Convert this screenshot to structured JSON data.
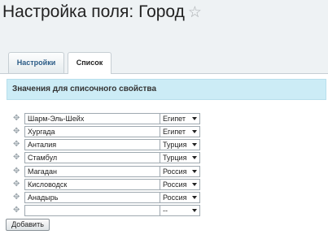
{
  "page": {
    "title": "Настройка поля: Город",
    "star_icon": "☆"
  },
  "tabs": [
    {
      "label": "Настройки"
    },
    {
      "label": "Список"
    }
  ],
  "section": {
    "title": "Значения для списочного свойства"
  },
  "rows": [
    {
      "value": "Шарм-Эль-Шейх",
      "country": "Египет"
    },
    {
      "value": "Хургада",
      "country": "Египет"
    },
    {
      "value": "Анталия",
      "country": "Турция"
    },
    {
      "value": "Стамбул",
      "country": "Турция"
    },
    {
      "value": "Магадан",
      "country": "Россия"
    },
    {
      "value": "Кисловодск",
      "country": "Россия"
    },
    {
      "value": "Анадырь",
      "country": "Россия"
    },
    {
      "value": "",
      "country": "--"
    }
  ],
  "drag_icon": "✥",
  "add_button": {
    "label": "Добавить"
  }
}
